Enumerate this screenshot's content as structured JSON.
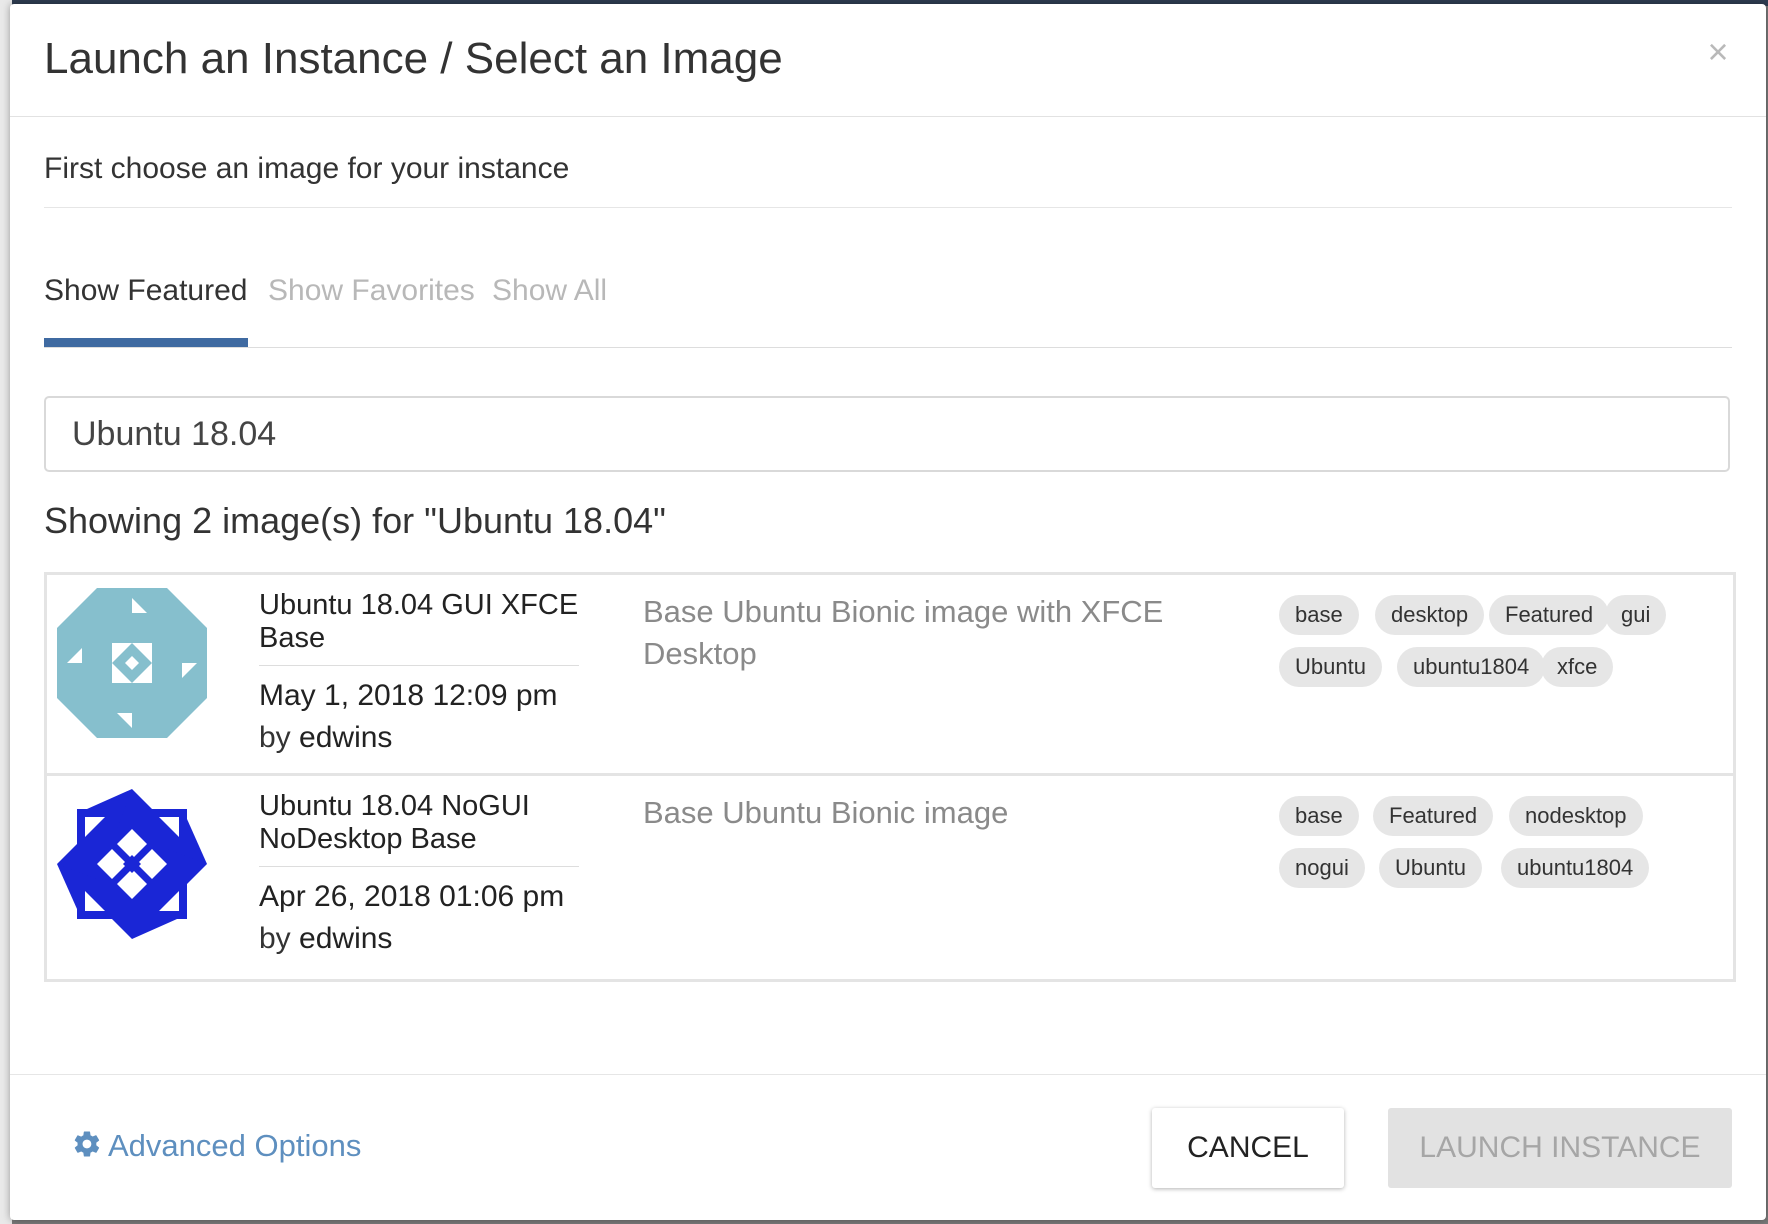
{
  "modal": {
    "title": "Launch an Instance / Select an Image",
    "close_label": "×",
    "subtitle": "First choose an image for your instance"
  },
  "tabs": [
    {
      "label": "Show Featured",
      "active": true
    },
    {
      "label": "Show Favorites",
      "active": false
    },
    {
      "label": "Show All",
      "active": false
    }
  ],
  "search": {
    "value": "Ubuntu 18.04",
    "placeholder": "Search"
  },
  "results": {
    "heading": "Showing 2 image(s) for \"Ubuntu 18.04\""
  },
  "images": [
    {
      "name": "Ubuntu 18.04 GUI XFCE Base",
      "date": "May 1, 2018 12:09 pm",
      "by_label": "by",
      "author": "edwins",
      "description": "Base Ubuntu Bionic image with XFCE Desktop",
      "avatar_color": "#86bfcd",
      "tags": [
        "base",
        "desktop",
        "Featured",
        "gui",
        "Ubuntu",
        "ubuntu1804",
        "xfce"
      ]
    },
    {
      "name": "Ubuntu 18.04 NoGUI NoDesktop Base",
      "date": "Apr 26, 2018 01:06 pm",
      "by_label": "by",
      "author": "edwins",
      "description": "Base Ubuntu Bionic image",
      "avatar_color": "#1a26d6",
      "tags": [
        "base",
        "Featured",
        "nodesktop",
        "nogui",
        "Ubuntu",
        "ubuntu1804"
      ]
    }
  ],
  "footer": {
    "advanced_label": "Advanced Options",
    "advanced_icon": "gear-icon",
    "cancel_label": "CANCEL",
    "launch_label": "LAUNCH INSTANCE"
  },
  "colors": {
    "accent": "#3f6aa1",
    "link": "#5e8fbf",
    "tag_bg": "#e6e6e6",
    "disabled_btn_bg": "#e2e2e2"
  }
}
